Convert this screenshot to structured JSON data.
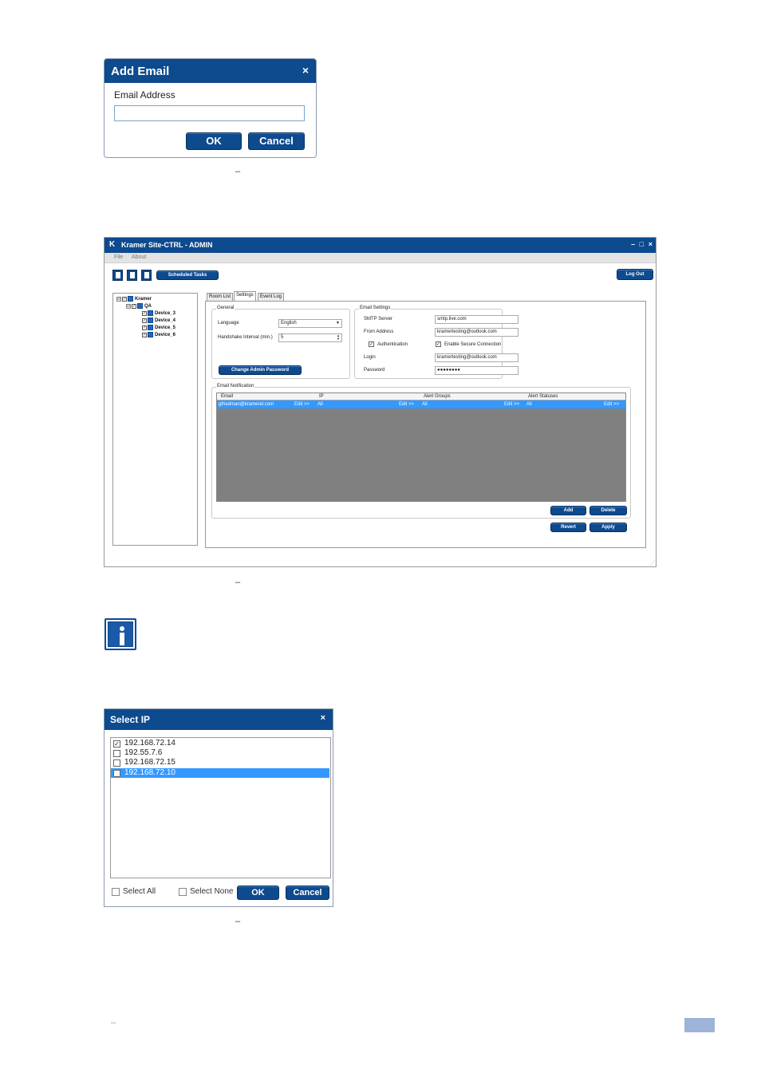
{
  "add_email_dialog": {
    "title": "Add Email",
    "close_glyph": "×",
    "field_label": "Email Address",
    "field_value": "",
    "ok_label": "OK",
    "cancel_label": "Cancel"
  },
  "captions": {
    "dash_1": "–",
    "dash_2": "–",
    "dash_3": "–",
    "dash_4": "–"
  },
  "app_window": {
    "title": "Kramer Site-CTRL - ADMIN",
    "logo": "K",
    "window_controls": {
      "minimize": "–",
      "maximize": "□",
      "close": "×"
    },
    "menu": [
      "File",
      "About"
    ],
    "toolbar": {
      "icons": [
        "new-file-icon",
        "open-book-icon",
        "save-icon"
      ],
      "scheduled_tasks_label": "Scheduled Tasks",
      "logout_label": "Log Out"
    },
    "tree": {
      "root": "Kramer",
      "group": "QA",
      "devices": [
        "Device_3",
        "Device_4",
        "Device_5",
        "Device_6"
      ],
      "expand_glyph": "⊟",
      "check_glyph": "✓"
    },
    "tabs": [
      "Room List",
      "Settings",
      "Event Log"
    ],
    "active_tab": "Settings",
    "general": {
      "title": "General",
      "language_label": "Language",
      "language_value": "English",
      "handshake_label": "Handshake Interval (min.)",
      "handshake_value": "5",
      "change_password_label": "Change Admin Password"
    },
    "email_settings": {
      "title": "Email Settings",
      "smtp_label": "SMTP Server",
      "smtp_value": "smtp.live.com",
      "from_label": "From Address",
      "from_value": "kramertesting@outlook.com",
      "auth_label": "Authentication",
      "auth_checked": true,
      "secure_label": "Enable Secure Connection",
      "secure_checked": true,
      "login_label": "Login",
      "login_value": "kramertesting@outlook.com",
      "password_label": "Password",
      "password_value": "●●●●●●●●"
    },
    "email_notification": {
      "title": "Email Notification",
      "columns": [
        "Email",
        "IP",
        "Alert Groups",
        "Alert Statuses"
      ],
      "rows": [
        {
          "email": "gfriedman@kramerel.com",
          "email_edit": "Edit >>",
          "ip": "All",
          "ip_edit": "Edit >>",
          "groups": "All",
          "groups_edit": "Edit >>",
          "statuses": "All",
          "statuses_edit": "Edit >>"
        }
      ],
      "add_label": "Add",
      "delete_label": "Delete"
    },
    "revert_label": "Revert",
    "apply_label": "Apply"
  },
  "select_ip_dialog": {
    "title": "Select IP",
    "close_glyph": "×",
    "items": [
      {
        "ip": "192.168.72.14",
        "checked": true
      },
      {
        "ip": "192.55.7.6",
        "checked": false
      },
      {
        "ip": "192.168.72.15",
        "checked": false
      },
      {
        "ip": "192.168.72.10",
        "checked": false,
        "selected": true
      }
    ],
    "select_all_label": "Select All",
    "select_none_label": "Select None",
    "ok_label": "OK",
    "cancel_label": "Cancel"
  },
  "colors": {
    "brand_blue": "#0d4a8e",
    "selection_blue": "#3399ff",
    "grid_background": "#808080"
  }
}
